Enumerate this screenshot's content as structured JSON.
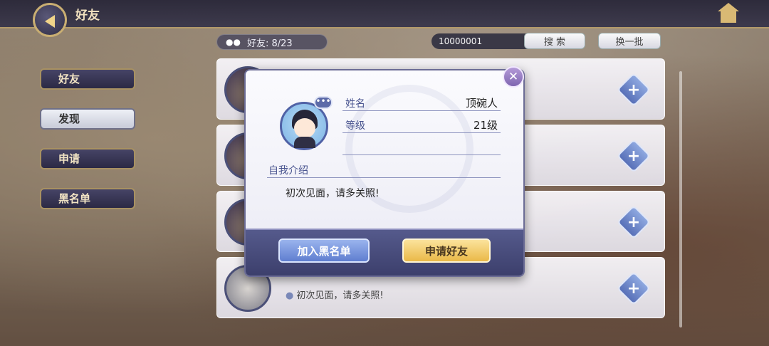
{
  "header": {
    "title": "好友"
  },
  "toolbar": {
    "friend_count": "好友: 8/23",
    "search_value": "10000001",
    "search_label": "搜 索",
    "refresh_label": "换一批"
  },
  "sidebar": {
    "items": [
      {
        "label": "好友",
        "active": false
      },
      {
        "label": "发现",
        "active": true
      },
      {
        "label": "申请",
        "active": false
      },
      {
        "label": "黑名单",
        "active": false
      }
    ]
  },
  "list": {
    "rows": [
      {
        "bio": ""
      },
      {
        "bio": ""
      },
      {
        "bio": ""
      },
      {
        "bio": "初次见面，请多关照!"
      }
    ]
  },
  "modal": {
    "name_label": "姓名",
    "name_value": "顶碗人",
    "level_label": "等级",
    "level_value": "21级",
    "intro_label": "自我介绍",
    "intro_text": "初次见面，请多关照!",
    "blacklist_button": "加入黑名单",
    "apply_button": "申请好友",
    "close_glyph": "✕",
    "chat_glyph": "•••"
  },
  "colors": {
    "accent_gold": "#eab948",
    "accent_blue": "#5f7ed0",
    "frame": "#5062a6"
  }
}
